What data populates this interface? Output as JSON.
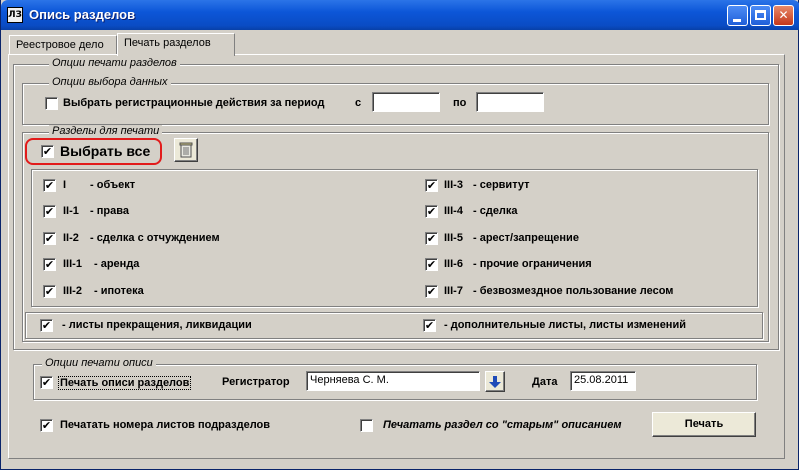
{
  "window": {
    "title": "Опись разделов",
    "icon_text": "ЛЗ"
  },
  "tabs": [
    {
      "label": "Реестровое дело",
      "active": false
    },
    {
      "label": "Печать разделов",
      "active": true
    }
  ],
  "print_options": {
    "legend": "Опции печати разделов",
    "data_selection": {
      "legend": "Опции выбора данных",
      "period_checkbox_label": "Выбрать регистрационные действия за период",
      "period_checked": false,
      "from_label": "с",
      "from_value": "",
      "to_label": "по",
      "to_value": ""
    },
    "sections": {
      "legend": "Разделы для печати",
      "select_all_label": "Выбрать все",
      "select_all_checked": true,
      "left": [
        {
          "code": "I",
          "name": "- объект",
          "checked": true
        },
        {
          "code": "II-1",
          "name": "- права",
          "checked": true
        },
        {
          "code": "II-2",
          "name": "- сделка с отчуждением",
          "checked": true
        },
        {
          "code": "III-1",
          "name": "- аренда",
          "checked": true
        },
        {
          "code": "III-2",
          "name": "- ипотека",
          "checked": true
        }
      ],
      "right": [
        {
          "code": "III-3",
          "name": "- сервитут",
          "checked": true
        },
        {
          "code": "III-4",
          "name": "- сделка",
          "checked": true
        },
        {
          "code": "III-5",
          "name": "- арест/запрещение",
          "checked": true
        },
        {
          "code": "III-6",
          "name": "- прочие ограничения",
          "checked": true
        },
        {
          "code": "III-7",
          "name": "- безвозмездное пользование лесом",
          "checked": true
        }
      ],
      "extra_left": {
        "label": "- листы прекращения, ликвидации",
        "checked": true
      },
      "extra_right": {
        "label": "- дополнительные листы, листы изменений",
        "checked": true
      }
    }
  },
  "inventory_options": {
    "legend": "Опции печати описи",
    "print_inventory_label": "Печать описи разделов",
    "print_inventory_checked": true,
    "registrar_label": "Регистратор",
    "registrar_value": "Черняева С. М.",
    "date_label": "Дата",
    "date_value": "25.08.2011"
  },
  "footer": {
    "print_numbers_label": "Печатать номера листов подразделов",
    "print_numbers_checked": true,
    "old_description_label": "Печатать раздел со \"старым\" описанием",
    "old_description_checked": false,
    "print_button_label": "Печать"
  },
  "check_glyph": "✔",
  "colors": {
    "title_bar": "#0c56d8",
    "window_bg": "#d4d0c8",
    "highlight_oval": "#e21b1b"
  }
}
